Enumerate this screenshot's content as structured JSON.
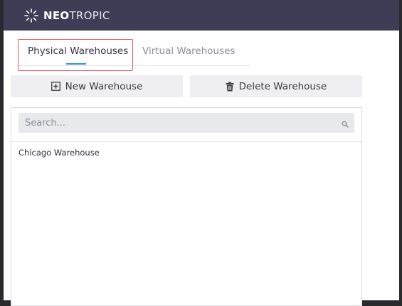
{
  "header": {
    "logo_bold": "NEO",
    "logo_thin": "TROPIC",
    "logo_icon": "sunburst-logo-icon"
  },
  "tabs": [
    {
      "label": "Physical Warehouses",
      "active": true
    },
    {
      "label": "Virtual Warehouses",
      "active": false
    }
  ],
  "toolbar": {
    "new_label": "New Warehouse",
    "new_icon": "plus-square-icon",
    "delete_label": "Delete Warehouse",
    "delete_icon": "trash-icon"
  },
  "search": {
    "placeholder": "Search...",
    "value": "",
    "icon": "search-icon"
  },
  "warehouses": [
    {
      "name": "Chicago Warehouse"
    }
  ],
  "colors": {
    "topbar": "#3f3d55",
    "accent": "#2c97c9",
    "highlight": "#e2575a",
    "button_bg": "#efeff1"
  }
}
